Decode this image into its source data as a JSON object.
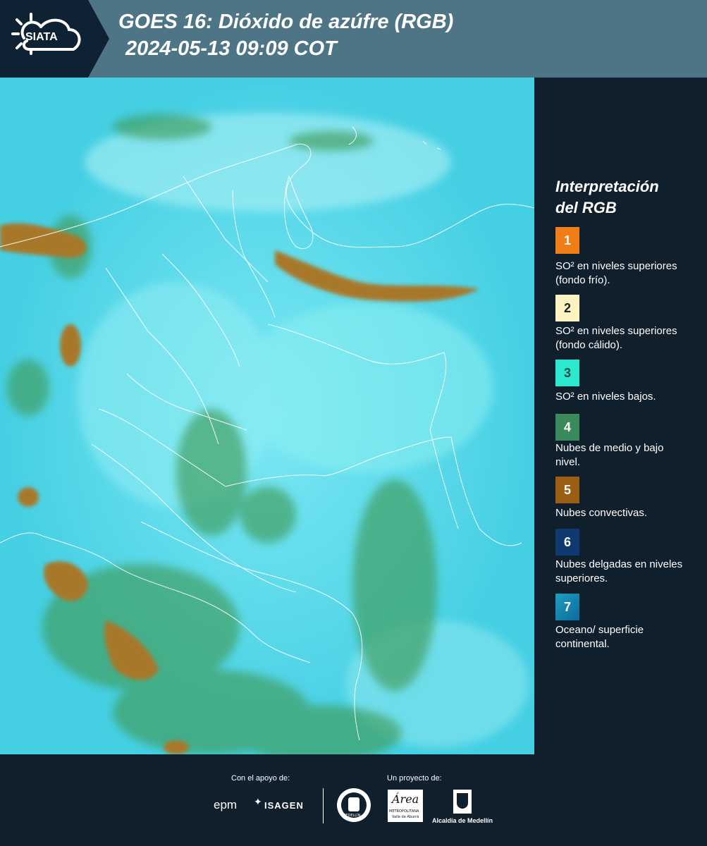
{
  "header": {
    "logo_text": "SIATA",
    "title_line1": "GOES 16: Dióxido de azúfre (RGB)",
    "title_line2": "2024-05-13 09:09 COT"
  },
  "legend": {
    "title_line1": "Interpretación",
    "title_line2": "del RGB",
    "items": [
      {
        "number": "1",
        "color": "#f07d16",
        "label": "SO² en niveles superiores (fondo frío)."
      },
      {
        "number": "2",
        "color": "#fdf3c0",
        "label": "SO² en niveles superiores (fondo cálido)."
      },
      {
        "number": "3",
        "color": "#2ce8cf",
        "label": "SO² en niveles bajos."
      },
      {
        "number": "4",
        "color": "#3a8a5c",
        "label": "Nubes de medio y bajo nivel."
      },
      {
        "number": "5",
        "color": "#9a5f14",
        "label": "Nubes convectivas."
      },
      {
        "number": "6",
        "color": "#0e3a70",
        "label": "Nubes delgadas en niveles superiores."
      },
      {
        "number": "7",
        "color": "#1a8fb0",
        "label": "Oceano/ superficie continental."
      }
    ]
  },
  "footer": {
    "support_label": "Con el apoyo de:",
    "project_label": "Un proyecto de:",
    "brand_epm": "epm",
    "brand_isagen": "ISAGEN",
    "brand_area": "Área",
    "brand_area_sub": "METROPOLITANA",
    "brand_area_sub2": "Valle de Aburrá",
    "brand_alcaldia": "Alcaldía de Medellín",
    "brand_medellin_seal": "MEDELLÍN"
  },
  "colors": {
    "header_bg": "#4d7585",
    "logo_bg": "#0f2233",
    "panel_bg": "#0f1f2c",
    "map_cyan": "#4fd3e6",
    "cloud_green": "#3f9c5a",
    "convective_brown": "#a8782a"
  }
}
